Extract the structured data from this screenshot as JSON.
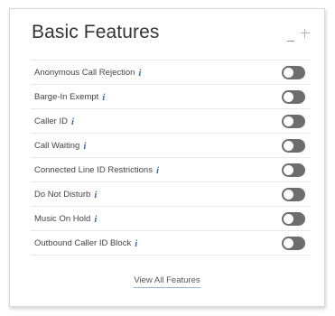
{
  "panel": {
    "title": "Basic Features",
    "minimize_icon": "minimize-icon",
    "move_icon": "move-icon"
  },
  "features": [
    {
      "label": "Anonymous Call Rejection",
      "enabled": false
    },
    {
      "label": "Barge-In Exempt",
      "enabled": false
    },
    {
      "label": "Caller ID",
      "enabled": false
    },
    {
      "label": "Call Waiting",
      "enabled": false
    },
    {
      "label": "Connected Line ID Restrictions",
      "enabled": false
    },
    {
      "label": "Do Not Disturb",
      "enabled": false
    },
    {
      "label": "Music On Hold",
      "enabled": false
    },
    {
      "label": "Outbound Caller ID Block",
      "enabled": false
    }
  ],
  "info_glyph": "i",
  "footer": {
    "view_all_label": "View All Features"
  },
  "colors": {
    "toggle_off": "#6d6d6d",
    "info_icon": "#3a6fb0",
    "link_underline": "#9bb6d6"
  }
}
